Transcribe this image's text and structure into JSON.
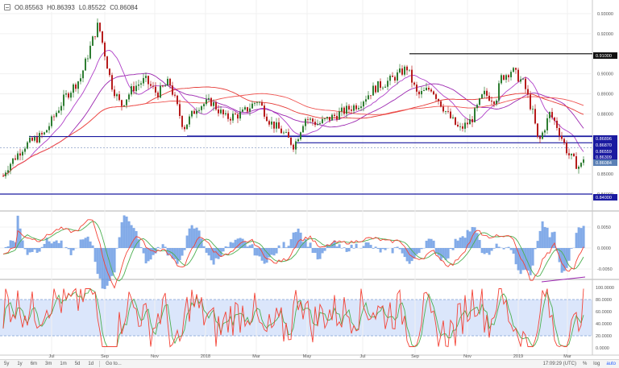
{
  "ohlc": {
    "open": "O0.85563",
    "high": "H0.86393",
    "low": "L0.85522",
    "close": "C0.86084"
  },
  "price_axis": {
    "ticks": [
      "0.93000",
      "0.92000",
      "0.90000",
      "0.89000",
      "0.88000",
      "0.86000",
      "0.85000",
      "0.84000"
    ],
    "hline_labels": [
      "0.91000",
      "0.86896",
      "0.86870",
      "0.86559",
      "0.86309",
      "0.86084",
      "0.84000"
    ]
  },
  "macd_axis": {
    "ticks": [
      "0.0050",
      "0.0000",
      "-0.0050"
    ]
  },
  "stoch_axis": {
    "ticks": [
      "100.0000",
      "80.0000",
      "60.0000",
      "40.0000",
      "20.0000",
      "0.0000"
    ]
  },
  "time_axis": {
    "labels": [
      "Jul",
      "Sep",
      "Nov",
      "2018",
      "Mar",
      "May",
      "Jul",
      "Sep",
      "Nov",
      "2019",
      "Mar"
    ]
  },
  "toolbar": {
    "ranges": [
      "5y",
      "1y",
      "6m",
      "3m",
      "1m",
      "5d",
      "1d"
    ],
    "goto": "Go to...",
    "clock": "17:09:29 (UTC)",
    "pct": "%",
    "log": "log",
    "auto": "auto"
  },
  "colors": {
    "candle_up": "#2e7d32",
    "candle_down": "#b71c1c",
    "ma_purple": "#b040c8",
    "ma_violet": "#9c27b0",
    "ma_red": "#e53935",
    "ma_salmon": "#ef5350",
    "hline_blue": "#1a1aa0",
    "macd_red": "#f44336",
    "macd_green": "#4caf50",
    "macd_hist": "#5a8fe0",
    "stoch_band": "#dbe6fb",
    "current_price_bg": "#5a7fb5"
  }
}
